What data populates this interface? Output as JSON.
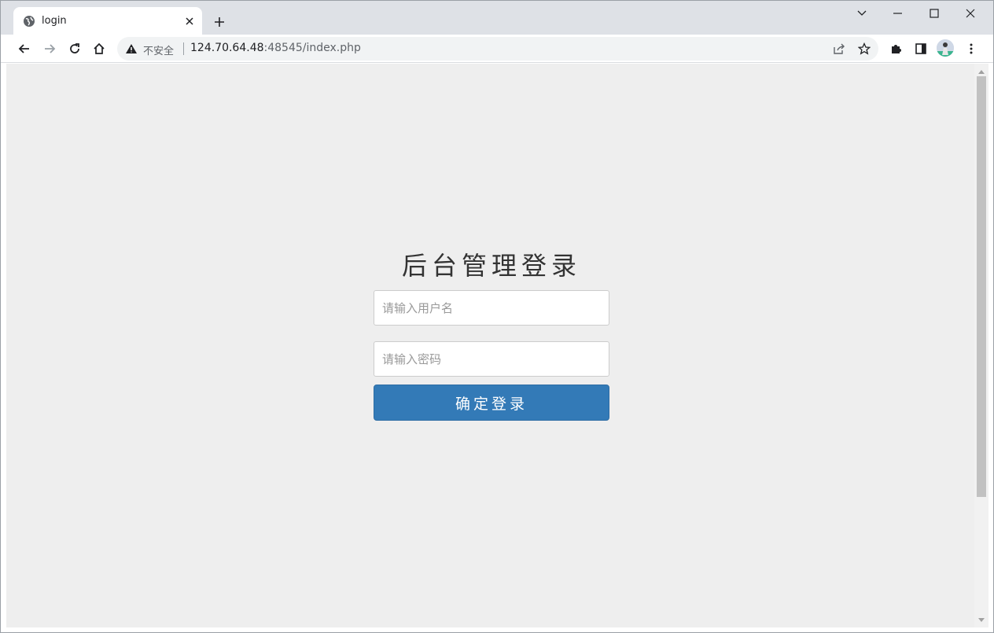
{
  "browser": {
    "tab": {
      "title": "login",
      "favicon": "globe-icon"
    },
    "new_tab_label": "+",
    "window_controls": [
      "tab-search-icon",
      "minimize-icon",
      "maximize-icon",
      "close-icon"
    ],
    "toolbar": {
      "back_icon": "back-arrow-icon",
      "forward_icon": "forward-arrow-icon",
      "reload_icon": "reload-icon",
      "home_icon": "home-icon"
    },
    "omnibox": {
      "security_label": "不安全",
      "url_host": "124.70.64.48",
      "url_rest": ":48545/index.php",
      "share_icon": "share-icon",
      "bookmark_icon": "star-icon"
    },
    "extensions_icon": "puzzle-icon",
    "side_panel_icon": "side-panel-icon",
    "menu_icon": "kebab-menu-icon"
  },
  "login": {
    "title": "后台管理登录",
    "username_placeholder": "请输入用户名",
    "password_placeholder": "请输入密码",
    "submit_label": "确定登录"
  },
  "colors": {
    "page_bg": "#eeeeee",
    "button_bg": "#337ab7",
    "tabstrip_bg": "#dee1e6"
  }
}
